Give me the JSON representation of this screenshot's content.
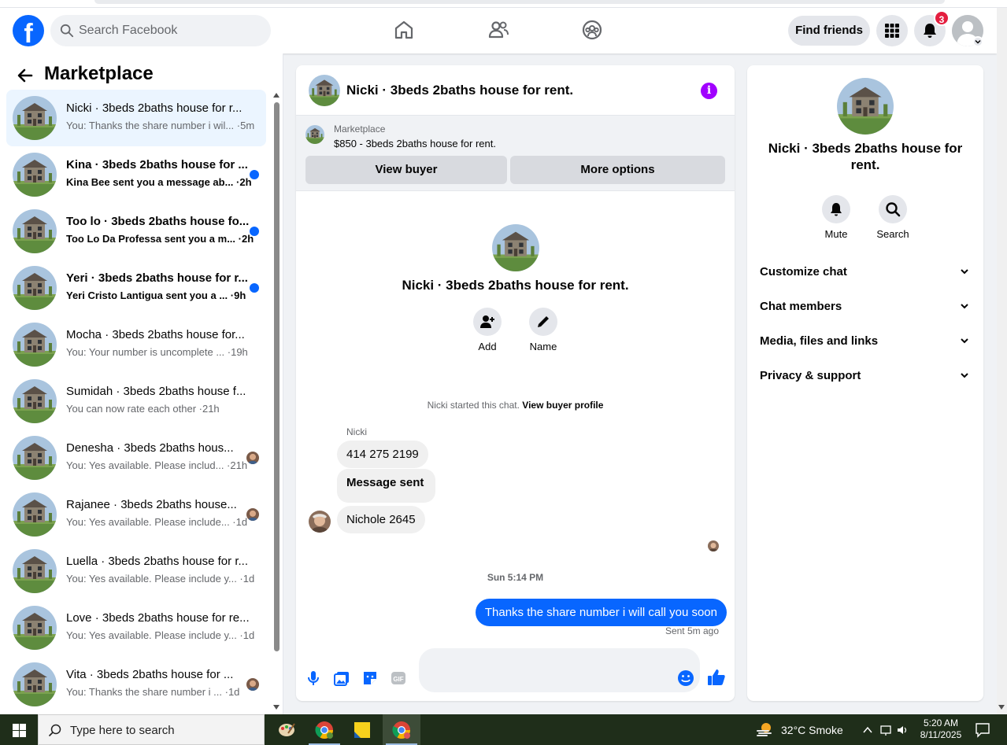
{
  "header": {
    "search_placeholder": "Search Facebook",
    "find_friends_label": "Find friends",
    "notification_count": "3"
  },
  "left_panel": {
    "title": "Marketplace",
    "conversations": [
      {
        "title": "Nicki · 3beds 2baths house for r...",
        "preview": "You: Thanks the share number i wil... ·5m",
        "unread": false,
        "active": true,
        "indicator": "none"
      },
      {
        "title": "Kina · 3beds 2baths house for ...",
        "preview": "Kina Bee sent you a message ab... ·2h",
        "unread": true,
        "active": false,
        "indicator": "dot"
      },
      {
        "title": "Too lo · 3beds 2baths house fo...",
        "preview": "Too Lo Da Professa sent you a m... ·2h",
        "unread": true,
        "active": false,
        "indicator": "dot"
      },
      {
        "title": "Yeri · 3beds 2baths house for r...",
        "preview": "Yeri Cristo Lantigua sent you a ... ·9h",
        "unread": true,
        "active": false,
        "indicator": "dot"
      },
      {
        "title": "Mocha · 3beds 2baths house for...",
        "preview": "You: Your number is uncomplete ...  ·19h",
        "unread": false,
        "active": false,
        "indicator": "none"
      },
      {
        "title": "Sumidah · 3beds 2baths house f...",
        "preview": "You can now rate each other ·21h",
        "unread": false,
        "active": false,
        "indicator": "none"
      },
      {
        "title": "Denesha · 3beds 2baths hous...",
        "preview": "You: Yes available. Please includ... ·21h",
        "unread": false,
        "active": false,
        "indicator": "avatar"
      },
      {
        "title": "Rajanee · 3beds 2baths house...",
        "preview": "You: Yes available. Please include... ·1d",
        "unread": false,
        "active": false,
        "indicator": "avatar"
      },
      {
        "title": "Luella · 3beds 2baths house for r...",
        "preview": "You: Yes available. Please include y... ·1d",
        "unread": false,
        "active": false,
        "indicator": "none"
      },
      {
        "title": "Love · 3beds 2baths house for re...",
        "preview": "You: Yes available. Please include y... ·1d",
        "unread": false,
        "active": false,
        "indicator": "none"
      },
      {
        "title": "Vita · 3beds 2baths house for ...",
        "preview": "You: Thanks the share number i ... ·1d",
        "unread": false,
        "active": false,
        "indicator": "avatar"
      }
    ]
  },
  "chat": {
    "name": "Nicki · 3beds 2baths house for rent.",
    "listing_source": "Marketplace",
    "listing_desc": "$850 - 3beds 2baths house for rent.",
    "view_buyer_label": "View buyer",
    "more_options_label": "More options",
    "add_label": "Add",
    "name_label": "Name",
    "started_text": "Nicki started this chat.",
    "view_profile_link": "View buyer profile",
    "sender_name": "Nicki",
    "incoming_messages": [
      "414 275 2199",
      "Message sent",
      "Nichole  2645"
    ],
    "timestamp": "Sun 5:14 PM",
    "outgoing_message": "Thanks the share number i will call you soon",
    "sent_status": "Sent 5m ago"
  },
  "right_panel": {
    "name_line1": "Nicki · 3beds 2baths house for",
    "name_line2": "rent.",
    "mute_label": "Mute",
    "search_label": "Search",
    "sections": [
      "Customize chat",
      "Chat members",
      "Media, files and links",
      "Privacy & support"
    ]
  },
  "taskbar": {
    "search_placeholder": "Type here to search",
    "weather": "32°C  Smoke",
    "time": "5:20 AM",
    "date": "8/11/2025"
  },
  "colors": {
    "brand_blue": "#0866ff",
    "badge_red": "#e41e3f",
    "info_purple": "#a100ff"
  }
}
